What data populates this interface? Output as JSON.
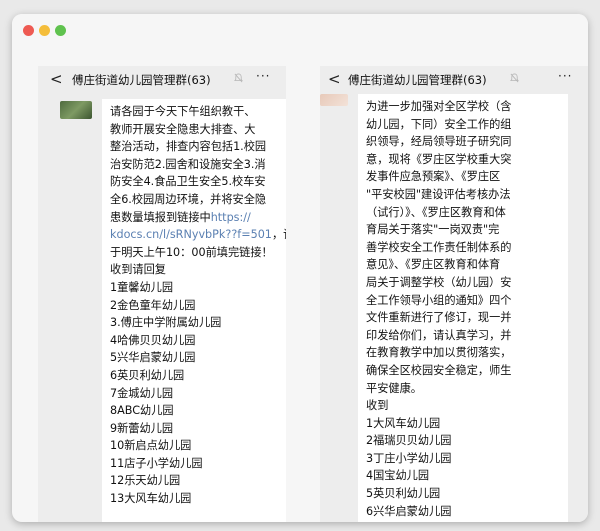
{
  "chat": {
    "title": "傅庄街道幼儿园管理群(63)",
    "back_glyph": "<",
    "more_glyph": "···"
  },
  "left_message": {
    "lines": [
      {
        "text": "请各园于今天下午组织教干、"
      },
      {
        "text": "教师开展安全隐患大排查、大"
      },
      {
        "text": "整治活动，排查内容包括1.校园"
      },
      {
        "text": "治安防范2.园舍和设施安全3.消"
      },
      {
        "text": "防安全4.食品卫生安全5.校车安"
      },
      {
        "text": "全6.校园周边环境，并将安全隐"
      },
      {
        "text": "患数量填报到链接中",
        "link": "https://"
      },
      {
        "link": "kdocs.cn/l/sRNyvbPk??f=501",
        "text": "，请"
      },
      {
        "text": "于明天上午10：00前填完链接！"
      },
      {
        "text": "收到请回复"
      },
      {
        "text": "1童馨幼儿园"
      },
      {
        "text": "2金色童年幼儿园"
      },
      {
        "text": "3.傅庄中学附属幼儿园"
      },
      {
        "text": "4哈佛贝贝幼儿园"
      },
      {
        "text": "5兴华启蒙幼儿园"
      },
      {
        "text": "6英贝利幼儿园"
      },
      {
        "text": "7金城幼儿园"
      },
      {
        "text": "8ABC幼儿园"
      },
      {
        "text": "9新蕾幼儿园"
      },
      {
        "text": "10新启点幼儿园"
      },
      {
        "text": "11店子小学幼儿园"
      },
      {
        "text": "12乐天幼儿园"
      },
      {
        "text": "13大风车幼儿园"
      }
    ]
  },
  "right_message": {
    "lines": [
      {
        "text": "为进一步加强对全区学校（含"
      },
      {
        "text": "幼儿园，下同）安全工作的组"
      },
      {
        "text": "织领导，经局领导班子研究同"
      },
      {
        "text": "意，现将《罗庄区学校重大突"
      },
      {
        "text": "发事件应急预案》、《罗庄区"
      },
      {
        "text": "\"平安校园\"建设评估考核办法"
      },
      {
        "text": "（试行）》、《罗庄区教育和体"
      },
      {
        "text": "育局关于落实\"一岗双责\"完"
      },
      {
        "text": "善学校安全工作责任制体系的"
      },
      {
        "text": "意见》、《罗庄区教育和体育"
      },
      {
        "text": "局关于调整学校（幼儿园）安"
      },
      {
        "text": "全工作领导小组的通知》四个"
      },
      {
        "text": "文件重新进行了修订，现一并"
      },
      {
        "text": "印发给你们，请认真学习，并"
      },
      {
        "text": "在教育教学中加以贯彻落实，"
      },
      {
        "text": "确保全区校园安全稳定，师生"
      },
      {
        "text": "平安健康。"
      },
      {
        "text": "收到"
      },
      {
        "text": "1大风车幼儿园"
      },
      {
        "text": "2福瑞贝贝幼儿园"
      },
      {
        "text": "3丁庄小学幼儿园"
      },
      {
        "text": "4国宝幼儿园"
      },
      {
        "text": "5英贝利幼儿园"
      },
      {
        "text": "6兴华启蒙幼儿园"
      }
    ]
  }
}
